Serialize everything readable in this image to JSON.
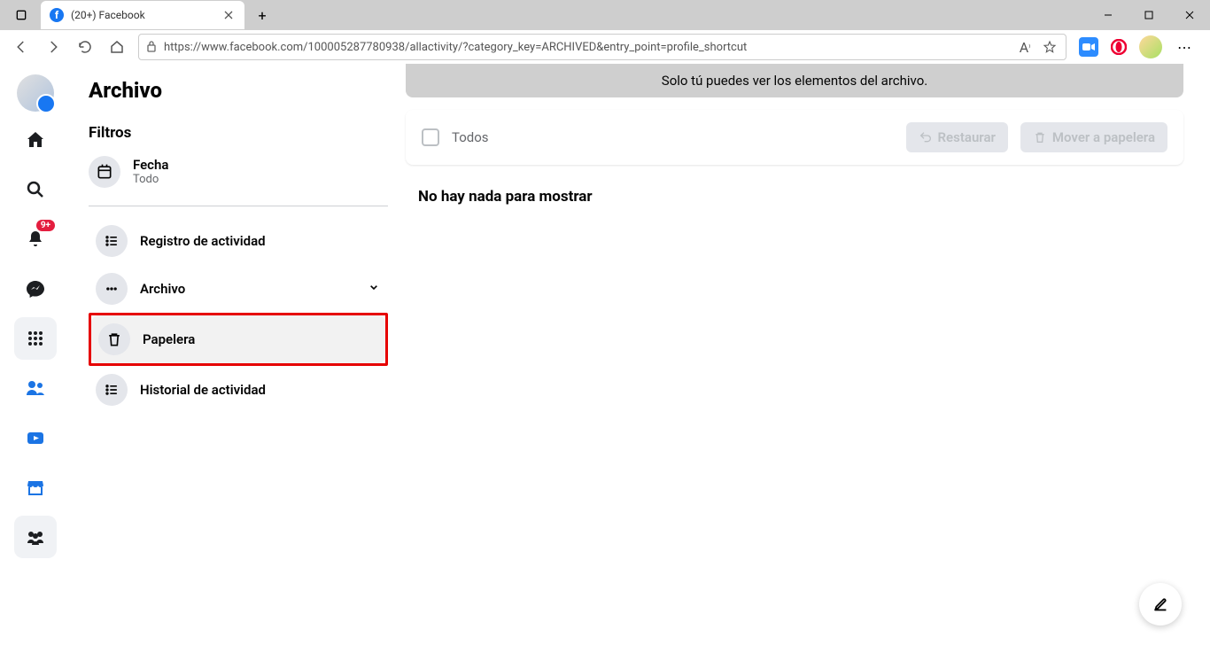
{
  "browser": {
    "tab_title": "(20+) Facebook",
    "url": "https://www.facebook.com/100005287780938/allactivity/?category_key=ARCHIVED&entry_point=profile_shortcut"
  },
  "rail": {
    "notif_badge": "9+"
  },
  "sidebar": {
    "title": "Archivo",
    "filters_heading": "Filtros",
    "filter_date_label": "Fecha",
    "filter_date_sub": "Todo",
    "nav": {
      "activity_log": "Registro de actividad",
      "archive": "Archivo",
      "trash": "Papelera",
      "activity_history": "Historial de actividad"
    }
  },
  "main": {
    "notice": "Solo tú puedes ver los elementos del archivo.",
    "select_all": "Todos",
    "restore": "Restaurar",
    "move_trash": "Mover a papelera",
    "empty": "No hay nada para mostrar"
  }
}
